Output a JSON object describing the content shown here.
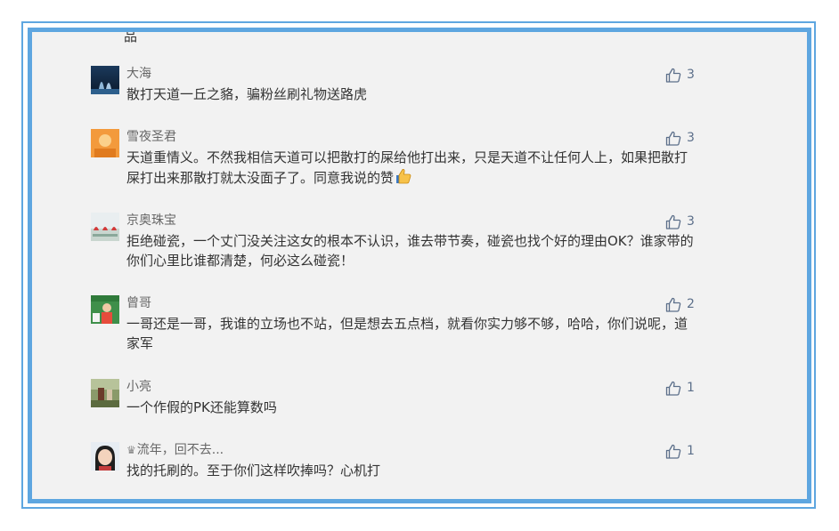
{
  "top_clipped_text": "品",
  "comments": [
    {
      "username": "大海",
      "text": "散打天道一丘之貉，骗粉丝刷礼物送路虎",
      "likes": "3",
      "avatar": "dolphin-avatar",
      "has_crown": false,
      "emoji": ""
    },
    {
      "username": "雪夜圣君",
      "text": "天道重情义。不然我相信天道可以把散打的屎给他打出来，只是天道不让任何人上，如果把散打屎打出来那散打就太没面子了。同意我说的赞",
      "likes": "3",
      "avatar": "orange-avatar",
      "has_crown": false,
      "emoji": "thumbs-up-emoji"
    },
    {
      "username": "京奥珠宝",
      "text": "拒绝碰瓷，一个丈门没关注这女的根本不认识，谁去带节奏，碰瓷也找个好的理由OK？谁家带的你们心里比谁都清楚，何必这么碰瓷！",
      "likes": "3",
      "avatar": "jewelry-avatar",
      "has_crown": false,
      "emoji": ""
    },
    {
      "username": "曾哥",
      "text": "一哥还是一哥，我谁的立场也不站，但是想去五点档，就看你实力够不够，哈哈，你们说呢，道家军",
      "likes": "2",
      "avatar": "green-avatar",
      "has_crown": false,
      "emoji": ""
    },
    {
      "username": "小亮",
      "text": "一个作假的PK还能算数吗",
      "likes": "1",
      "avatar": "outdoor-avatar",
      "has_crown": false,
      "emoji": ""
    },
    {
      "username": "流年，回不去...",
      "text": "找的托刷的。至于你们这样吹捧吗？心机打",
      "likes": "1",
      "avatar": "girl-avatar",
      "has_crown": true,
      "emoji": ""
    }
  ],
  "colors": {
    "frame": "#5ea6e0",
    "background": "#f2f2f2",
    "username": "#666666",
    "text": "#333333",
    "like": "#5c6f8a"
  }
}
